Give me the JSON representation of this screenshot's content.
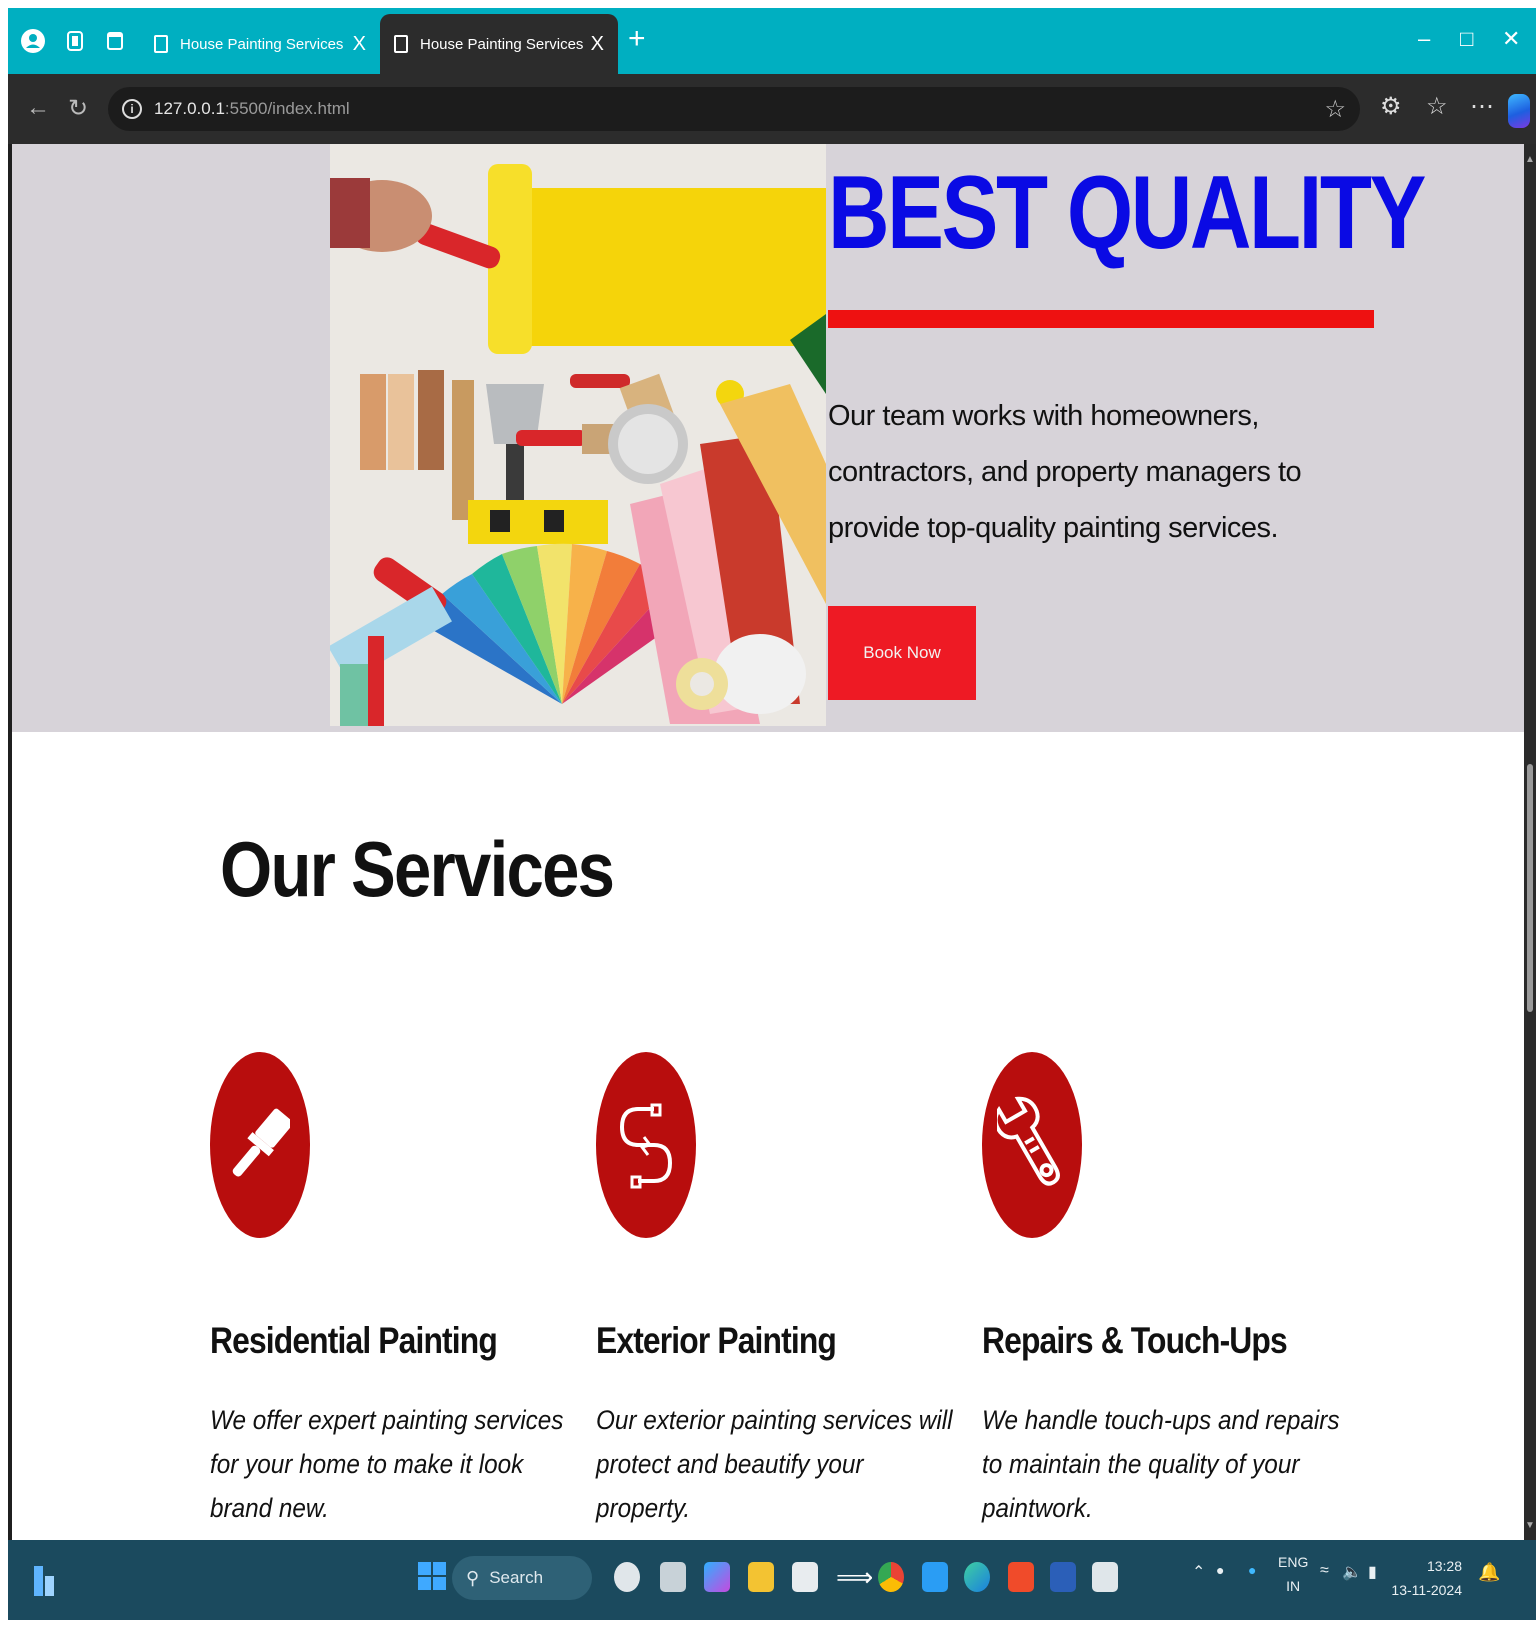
{
  "browser": {
    "tabs": [
      {
        "title": "House Painting Services",
        "active": false
      },
      {
        "title": "House Painting Services",
        "active": true
      }
    ],
    "new_tab_symbol": "+",
    "close_symbol": "X",
    "url_host": "127.0.0.1",
    "url_port_path": ":5500/index.html"
  },
  "hero": {
    "title": "BEST QUALITY",
    "text": "Our team works with homeowners, contractors, and property managers to provide top-quality painting services.",
    "button": "Book Now",
    "colors": {
      "title": "#0a0ae4",
      "accent": "#ee1111",
      "background": "#d7d3d9"
    }
  },
  "services": {
    "heading": "Our Services",
    "items": [
      {
        "title": "Residential Painting",
        "description": "We offer expert painting services for your home to make it look brand new.",
        "icon": "paintbrush-icon"
      },
      {
        "title": "Exterior Painting",
        "description": "Our exterior painting services will protect and beautify your property.",
        "icon": "magnet-icon"
      },
      {
        "title": "Repairs & Touch-Ups",
        "description": "We handle touch-ups and repairs to maintain the quality of your paintwork.",
        "icon": "wrench-icon"
      }
    ],
    "icon_color": "#b80d0d"
  },
  "taskbar": {
    "search_placeholder": "Search",
    "language": "ENG",
    "region": "IN",
    "time": "13:28",
    "date": "13-11-2024"
  }
}
